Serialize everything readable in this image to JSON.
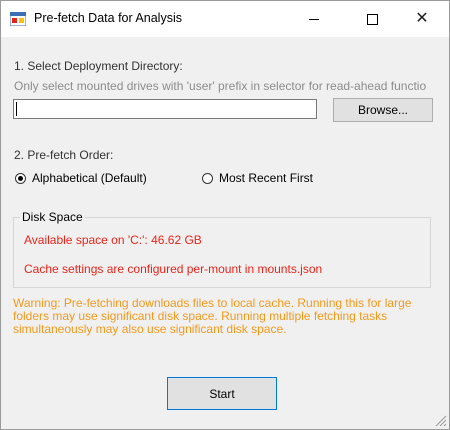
{
  "window": {
    "title": "Pre-fetch Data for Analysis",
    "icons": {
      "app": "app-window-icon",
      "minimize": "minimize-icon",
      "maximize": "maximize-icon",
      "close": "close-icon"
    }
  },
  "directory": {
    "label": "1. Select Deployment Directory:",
    "hint": "Only select mounted drives with 'user' prefix in selector for read-ahead functio",
    "value": "",
    "browse_label": "Browse..."
  },
  "order": {
    "label": "2. Pre-fetch Order:",
    "options": [
      {
        "label": "Alphabetical (Default)",
        "checked": true
      },
      {
        "label": "Most Recent First",
        "checked": false
      }
    ]
  },
  "disk_space": {
    "title": "Disk Space",
    "available": "Available space on 'C:': 46.62 GB",
    "cache_note": "Cache settings are configured per-mount in mounts.json"
  },
  "warning": "Warning: Pre-fetching downloads files to local cache. Running this for large folders may use significant disk space. Running multiple fetching tasks simultaneously may also use significant disk space.",
  "start_label": "Start",
  "colors": {
    "warning": "#f29a1b",
    "error": "#e8251b",
    "accent": "#0078d7"
  }
}
